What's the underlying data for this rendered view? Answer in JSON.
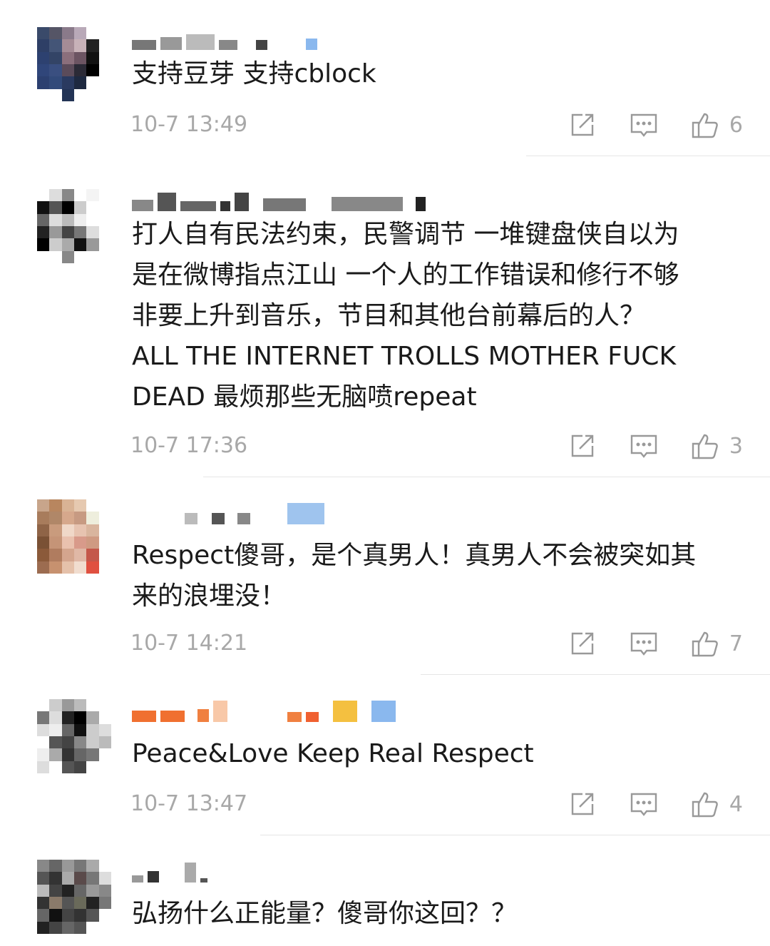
{
  "comments": [
    {
      "text": "支持豆芽 支持cblock",
      "time": "10-7 13:49",
      "likes": "6"
    },
    {
      "text": "打人自有民法约束，民警调节 一堆键盘侠自以为\n是在微博指点江山 一个人的工作错误和修行不够\n非要上升到音乐，节目和其他台前幕后的人？\nALL THE INTERNET TROLLS MOTHER FUCK\nDEAD 最烦那些无脑喷repeat",
      "time": "10-7 17:36",
      "likes": "3"
    },
    {
      "text": "Respect傻哥，是个真男人！真男人不会被突如其\n来的浪埋没！",
      "time": "10-7 14:21",
      "likes": "7"
    },
    {
      "text": "Peace&Love Keep Real Respect",
      "time": "10-7 13:47",
      "likes": "4"
    },
    {
      "text": "弘扬什么正能量？傻哥你这回？？"
    }
  ],
  "icons": {
    "repost": "repost-icon",
    "reply": "reply-icon",
    "like": "thumbs-up-icon"
  },
  "colors": {
    "meta_gray": "#a8a8a8",
    "icon_gray": "#999999",
    "text": "#1a1a1a"
  }
}
